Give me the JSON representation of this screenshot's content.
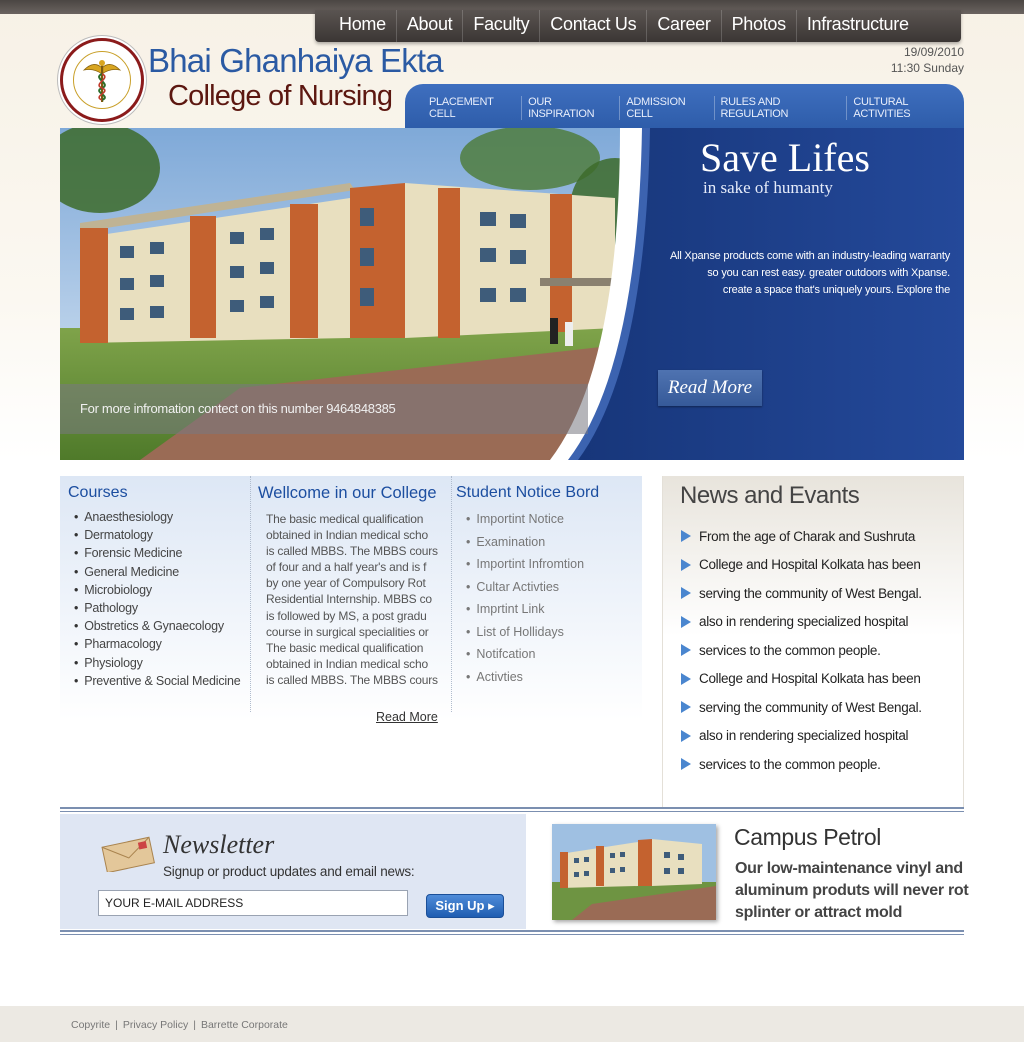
{
  "top_nav": [
    "Home",
    "About",
    "Faculty",
    "Contact Us",
    "Career",
    "Photos",
    "Infrastructure"
  ],
  "header": {
    "title_line1": "Bhai Ghanhaiya Ekta",
    "title_line2": "College of Nursing",
    "date": "19/09/2010",
    "time_day": "11:30 Sunday"
  },
  "sub_nav": [
    "PLACEMENT CELL",
    "OUR INSPIRATION",
    "ADMISSION CELL",
    "RULES AND REGULATION",
    "CULTURAL ACTIVITIES"
  ],
  "hero": {
    "title": "Save Lifes",
    "subtitle": "in sake of humanty",
    "text_lines": [
      "All Xpanse products come with an industry-leading warranty",
      "so you can rest easy. greater outdoors with Xpanse.",
      "create a space that's uniquely yours. Explore the"
    ],
    "read_more": "Read More",
    "contact": "For more infromation  contect on this number 9464848385"
  },
  "courses": {
    "heading": "Courses",
    "items": [
      "Anaesthesiology",
      "Dermatology",
      "Forensic Medicine",
      "General Medicine",
      "Microbiology",
      "Pathology",
      "Obstretics & Gynaecology",
      "Pharmacology",
      "Physiology",
      "Preventive & Social Medicine"
    ]
  },
  "welcome": {
    "heading": "Wellcome in our College",
    "lines": [
      "The basic medical  qualification",
      "obtained in Indian medical scho",
      "is called MBBS. The MBBS cours",
      "of four and a half year's and is f",
      "by one year of Compulsory  Rot",
      "Residential Internship. MBBS co",
      "is followed by MS, a post gradu",
      "course in surgical specialities or",
      "The basic medical  qualification",
      "obtained in Indian medical scho",
      "is called MBBS. The MBBS cours"
    ],
    "read_more": "Read More"
  },
  "notice": {
    "heading": "Student Notice Bord",
    "items": [
      "Importint Notice",
      "Examination",
      "Importint Infromtion",
      "Cultar Activties",
      "Imprtint Link",
      "List of Hollidays",
      "Notifcation",
      "Activties"
    ]
  },
  "news": {
    "heading": "News and Evants",
    "items": [
      "From the age of Charak and Sushruta",
      "College and Hospital Kolkata has been",
      "serving the  community of West Bengal.",
      "also in rendering specialized hospital",
      "services to the common people.",
      "College and Hospital Kolkata has been",
      "serving the  community of West Bengal.",
      "also in rendering specialized hospital",
      "services to the common people."
    ]
  },
  "newsletter": {
    "title": "Newsletter",
    "subtitle": "Signup or product updates and email news:",
    "input_value": "YOUR E-MAIL ADDRESS",
    "button": "Sign Up ▸"
  },
  "campus": {
    "title": "Campus Petrol",
    "lines": [
      "Our low-maintenance vinyl and",
      "aluminum produts will never rot",
      "splinter or attract mold"
    ]
  },
  "footer": [
    "Copyrite",
    "Privacy Policy",
    "Barrette Corporate"
  ],
  "colors": {
    "brand_blue": "#2b5aa3",
    "brand_maroon": "#5c1710",
    "hero_blue": "#1e3f86",
    "bullet_blue": "#4a86cf"
  }
}
